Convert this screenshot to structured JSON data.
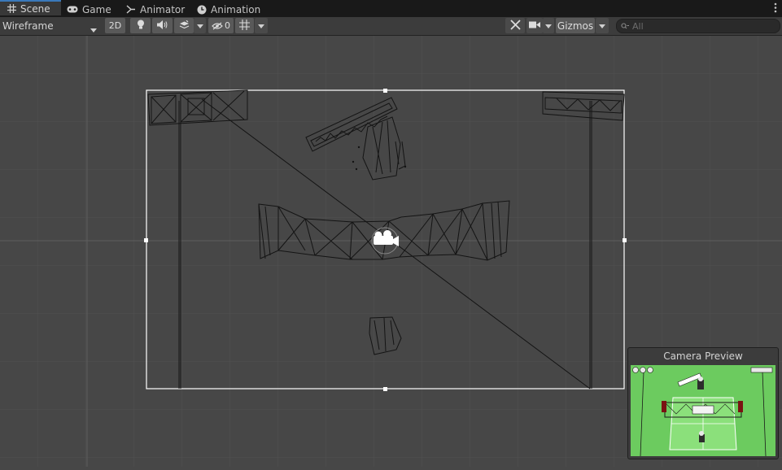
{
  "tabs": [
    {
      "label": "Scene",
      "icon": "grid-icon",
      "active": true
    },
    {
      "label": "Game",
      "icon": "gamepad-icon",
      "active": false
    },
    {
      "label": "Animator",
      "icon": "animator-icon",
      "active": false
    },
    {
      "label": "Animation",
      "icon": "clock-icon",
      "active": false
    }
  ],
  "toolbar": {
    "draw_mode": "Wireframe",
    "mode_2d": "2D",
    "hidden_count": "0",
    "gizmos": "Gizmos",
    "search_placeholder": "All"
  },
  "camera_preview": {
    "title": "Camera Preview"
  },
  "colors": {
    "scene_bg": "#474747",
    "wire": "#141414",
    "frame": "#ffffff",
    "preview_green": "#6ccb5f"
  }
}
